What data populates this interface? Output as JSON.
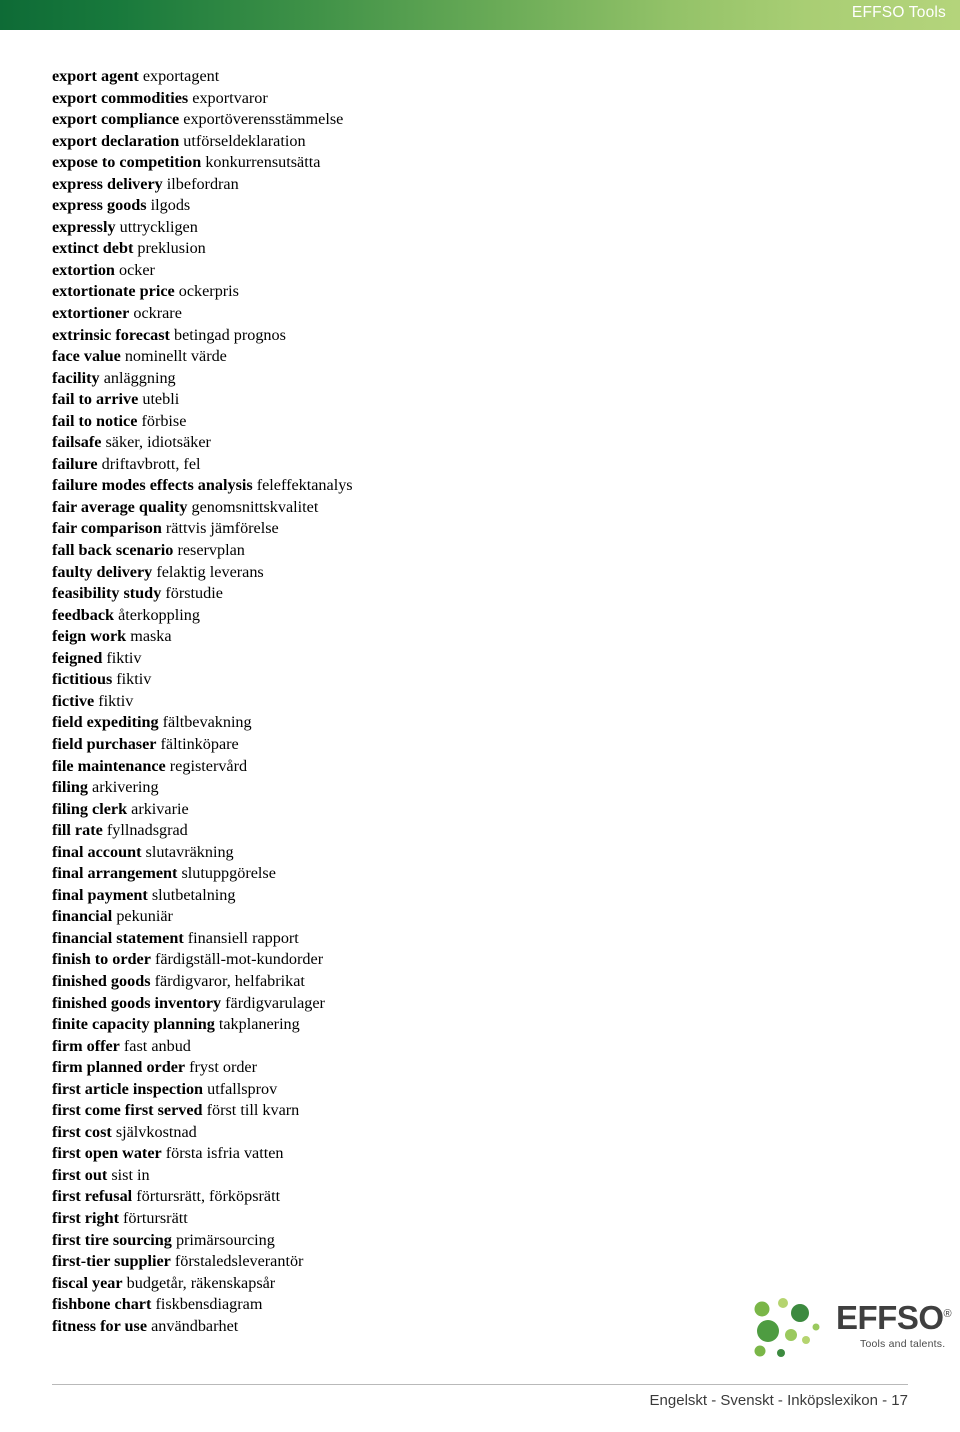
{
  "header": {
    "title": "EFFSO Tools",
    "gradient_from": "#0e6b36",
    "gradient_to": "#b4d47b"
  },
  "glossary": {
    "entries": [
      {
        "term": "export agent",
        "translation": "exportagent"
      },
      {
        "term": "export commodities",
        "translation": "exportvaror"
      },
      {
        "term": "export compliance",
        "translation": "exportöverensstämmelse"
      },
      {
        "term": "export declaration",
        "translation": "utförseldeklaration"
      },
      {
        "term": "expose to competition",
        "translation": "konkurrensutsätta"
      },
      {
        "term": "express delivery",
        "translation": "ilbefordran"
      },
      {
        "term": "express goods",
        "translation": "ilgods"
      },
      {
        "term": "expressly",
        "translation": "uttryckligen"
      },
      {
        "term": "extinct debt",
        "translation": "preklusion"
      },
      {
        "term": "extortion",
        "translation": "ocker"
      },
      {
        "term": "extortionate price",
        "translation": "ockerpris"
      },
      {
        "term": "extortioner",
        "translation": "ockrare"
      },
      {
        "term": "extrinsic forecast",
        "translation": "betingad prognos"
      },
      {
        "term": "face value",
        "translation": "nominellt värde"
      },
      {
        "term": "facility",
        "translation": "anläggning"
      },
      {
        "term": "fail to arrive",
        "translation": "utebli"
      },
      {
        "term": "fail to notice",
        "translation": "förbise"
      },
      {
        "term": "failsafe",
        "translation": "säker, idiotsäker"
      },
      {
        "term": "failure",
        "translation": "driftavbrott, fel"
      },
      {
        "term": "failure modes effects analysis",
        "translation": "feleffektanalys"
      },
      {
        "term": "fair average quality",
        "translation": "genomsnittskvalitet"
      },
      {
        "term": "fair comparison",
        "translation": "rättvis jämförelse"
      },
      {
        "term": "fall back scenario",
        "translation": "reservplan"
      },
      {
        "term": "faulty delivery",
        "translation": "felaktig leverans"
      },
      {
        "term": "feasibility study",
        "translation": "förstudie"
      },
      {
        "term": "feedback",
        "translation": "återkoppling"
      },
      {
        "term": "feign work",
        "translation": "maska"
      },
      {
        "term": "feigned",
        "translation": "fiktiv"
      },
      {
        "term": "fictitious",
        "translation": "fiktiv"
      },
      {
        "term": "fictive",
        "translation": "fiktiv"
      },
      {
        "term": "field expediting",
        "translation": "fältbevakning"
      },
      {
        "term": "field purchaser",
        "translation": "fältinköpare"
      },
      {
        "term": "file maintenance",
        "translation": "registervård"
      },
      {
        "term": "filing",
        "translation": "arkivering"
      },
      {
        "term": "filing clerk",
        "translation": "arkivarie"
      },
      {
        "term": "fill rate",
        "translation": "fyllnadsgrad"
      },
      {
        "term": "final account",
        "translation": "slutavräkning"
      },
      {
        "term": "final arrangement",
        "translation": "slutuppgörelse"
      },
      {
        "term": "final payment",
        "translation": "slutbetalning"
      },
      {
        "term": "financial",
        "translation": "pekuniär"
      },
      {
        "term": "financial statement",
        "translation": "finansiell rapport"
      },
      {
        "term": "finish to order",
        "translation": "färdigställ-mot-kundorder"
      },
      {
        "term": "finished goods",
        "translation": "färdigvaror, helfabrikat"
      },
      {
        "term": "finished goods inventory",
        "translation": "färdigvarulager"
      },
      {
        "term": "finite capacity planning",
        "translation": "takplanering"
      },
      {
        "term": "firm offer",
        "translation": "fast anbud"
      },
      {
        "term": "firm planned order",
        "translation": "fryst order"
      },
      {
        "term": "first article inspection",
        "translation": "utfallsprov"
      },
      {
        "term": "first come first served",
        "translation": "först till kvarn"
      },
      {
        "term": "first cost",
        "translation": "självkostnad"
      },
      {
        "term": "first open water",
        "translation": "första isfria vatten"
      },
      {
        "term": "first out",
        "translation": "sist in"
      },
      {
        "term": "first refusal",
        "translation": "förtursrätt, förköpsrätt"
      },
      {
        "term": "first right",
        "translation": "förtursrätt"
      },
      {
        "term": "first tire sourcing",
        "translation": "primärsourcing"
      },
      {
        "term": "first-tier supplier",
        "translation": "förstaledsleverantör"
      },
      {
        "term": "fiscal year",
        "translation": "budgetår, räkenskapsår"
      },
      {
        "term": "fishbone chart",
        "translation": "fiskbensdiagram"
      },
      {
        "term": "fitness for use",
        "translation": "användbarhet"
      }
    ]
  },
  "logo": {
    "wordmark": "EFFSO",
    "registered_mark": "®",
    "tagline": "Tools and talents.",
    "color_dark_green": "#3c8a3f",
    "color_mid_green": "#7ab648",
    "color_light_green": "#b5d46f"
  },
  "footer": {
    "text": "Engelskt - Svenskt - Inköpslexikon - 17"
  }
}
